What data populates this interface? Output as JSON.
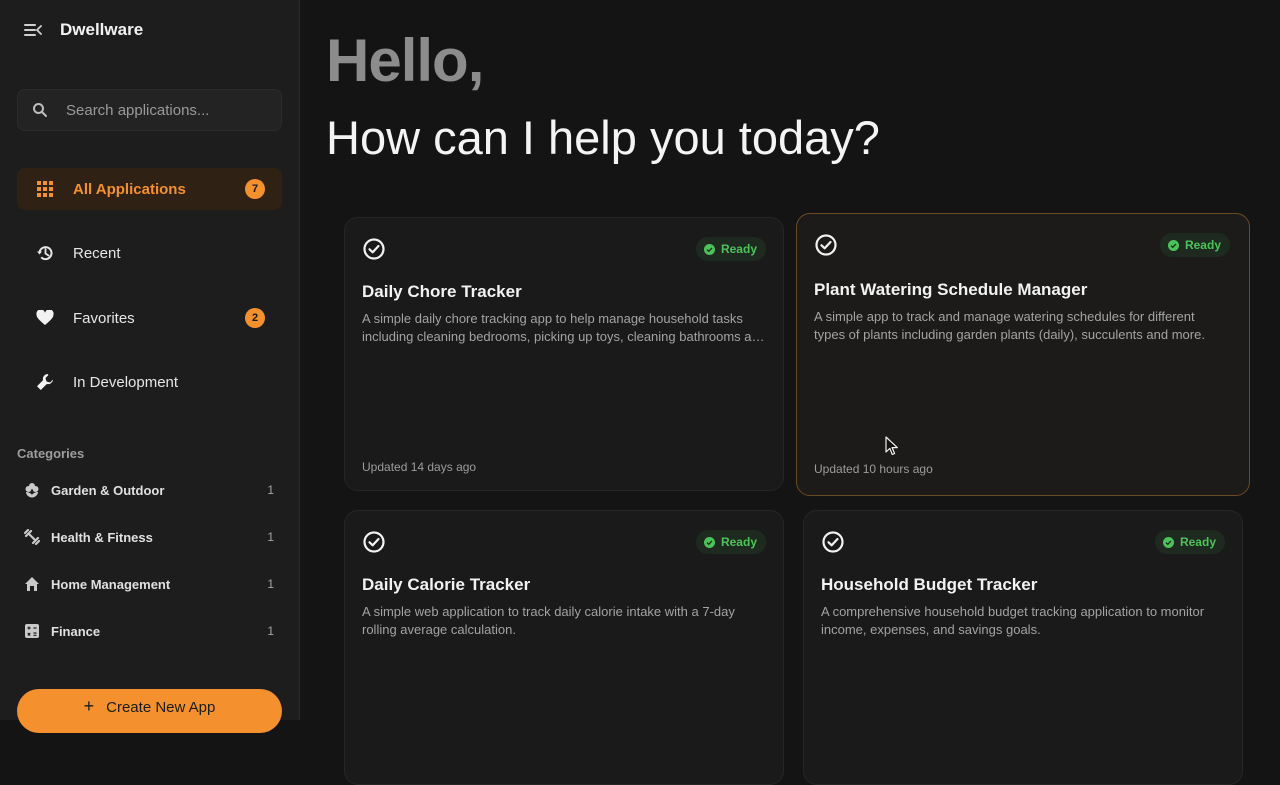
{
  "app": {
    "name": "Dwellware"
  },
  "search": {
    "placeholder": "Search applications..."
  },
  "nav": [
    {
      "label": "All Applications",
      "icon": "grid-icon",
      "badge": "7",
      "active": true
    },
    {
      "label": "Recent",
      "icon": "history-icon"
    },
    {
      "label": "Favorites",
      "icon": "heart-icon",
      "badge": "2"
    },
    {
      "label": "In Development",
      "icon": "wrench-icon"
    }
  ],
  "categories": {
    "heading": "Categories",
    "items": [
      {
        "label": "Garden & Outdoor",
        "count": "1",
        "icon": "flower-icon"
      },
      {
        "label": "Health & Fitness",
        "count": "1",
        "icon": "dumbbell-icon"
      },
      {
        "label": "Home Management",
        "count": "1",
        "icon": "home-icon"
      },
      {
        "label": "Finance",
        "count": "1",
        "icon": "calculator-icon"
      }
    ]
  },
  "create_button": {
    "label": "Create New App"
  },
  "greeting": {
    "hello": "Hello,",
    "subtitle": "How can I help you today?"
  },
  "cards": [
    {
      "title": "Daily Chore Tracker",
      "status": "Ready",
      "description": "A simple daily chore tracking app to help manage household tasks including cleaning bedrooms, picking up toys, cleaning bathrooms and more.",
      "updated": "Updated 14 days ago"
    },
    {
      "title": "Plant Watering Schedule Manager",
      "status": "Ready",
      "description": "A simple app to track and manage watering schedules for different types of plants including garden plants (daily), succulents and more.",
      "updated": "Updated 10 hours ago"
    },
    {
      "title": "Daily Calorie Tracker",
      "status": "Ready",
      "description": "A simple web application to track daily calorie intake with a 7-day rolling average calculation.",
      "updated": ""
    },
    {
      "title": "Household Budget Tracker",
      "status": "Ready",
      "description": "A comprehensive household budget tracking application to monitor income, expenses, and savings goals.",
      "updated": ""
    }
  ],
  "colors": {
    "accent": "#f5902e",
    "ready": "#4cc35a",
    "background": "#141414",
    "sidebar": "#1d1d1e"
  }
}
